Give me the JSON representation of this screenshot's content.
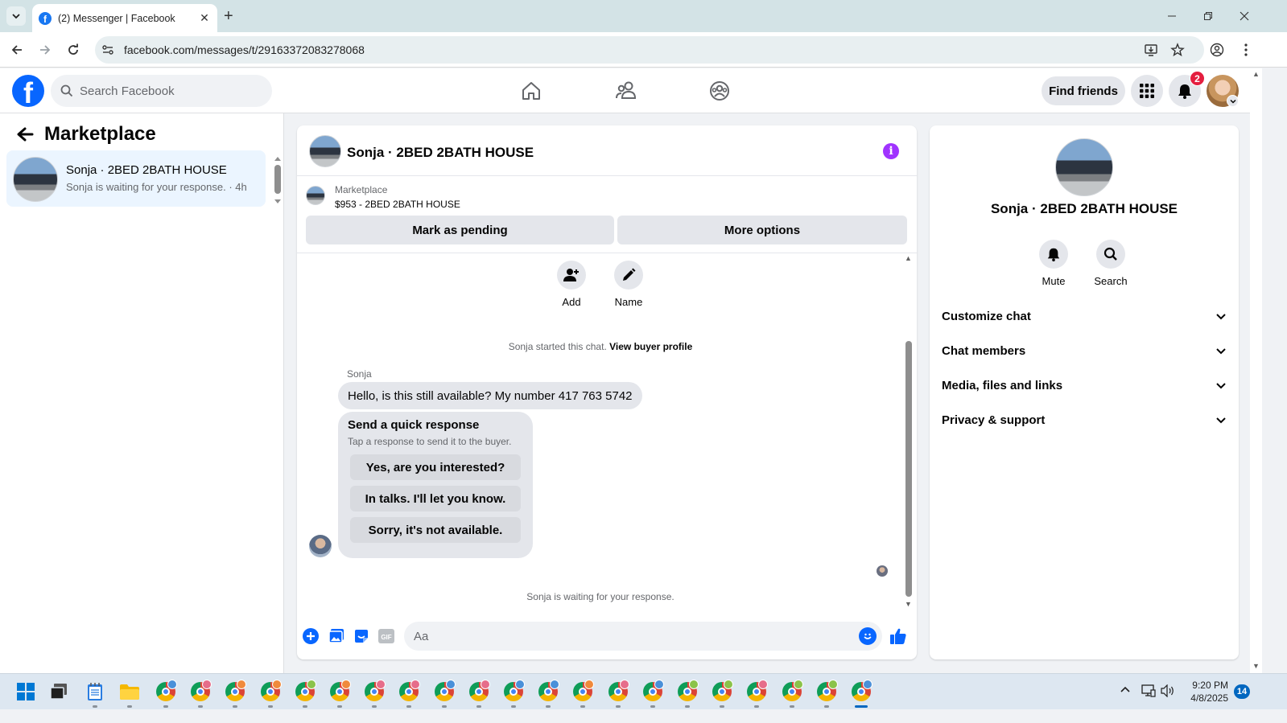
{
  "browser": {
    "tab_title": "(2) Messenger | Facebook",
    "url": "facebook.com/messages/t/29163372083278068"
  },
  "fb_header": {
    "search_placeholder": "Search Facebook",
    "find_friends_label": "Find friends",
    "notification_count": "2"
  },
  "left_pane": {
    "title": "Marketplace",
    "conversations": [
      {
        "name": "Sonja · 2BED 2BATH HOUSE",
        "preview": "Sonja is waiting for your response. · 4h"
      }
    ]
  },
  "chat": {
    "header_name": "Sonja · 2BED 2BATH HOUSE",
    "listing_source": "Marketplace",
    "listing_price_title": "$953 - 2BED 2BATH HOUSE",
    "mark_pending_label": "Mark as pending",
    "more_options_label": "More options",
    "add_label": "Add",
    "name_label": "Name",
    "started_text": "Sonja started this chat.",
    "view_profile_label": "View buyer profile",
    "sender_name": "Sonja",
    "message": "Hello, is this still available? My number 417 763 5742",
    "quick_title": "Send a quick response",
    "quick_subtitle": "Tap a response to send it to the buyer.",
    "quick_responses": [
      "Yes, are you interested?",
      "In talks. I'll let you know.",
      "Sorry, it's not available."
    ],
    "waiting_text": "Sonja is waiting for your response.",
    "composer_placeholder": "Aa"
  },
  "right_pane": {
    "name": "Sonja · 2BED 2BATH HOUSE",
    "mute_label": "Mute",
    "search_label": "Search",
    "sections": [
      "Customize chat",
      "Chat members",
      "Media, files and links",
      "Privacy & support"
    ]
  },
  "taskbar": {
    "time": "9:20 PM",
    "date": "4/8/2025",
    "notification_count": "14",
    "chrome_profile_colors": [
      "#4a90d9",
      "#e66d8a",
      "#f08a3c",
      "#f08a3c",
      "#8bc34a",
      "#f08a3c",
      "#e66d8a",
      "#e66d8a",
      "#4a90d9",
      "#e66d8a",
      "#4a90d9",
      "#4a90d9",
      "#f08a3c",
      "#e66d8a",
      "#4a90d9",
      "#8bc34a",
      "#8bc34a",
      "#e66d8a",
      "#8bc34a",
      "#8bc34a",
      "#4a90d9"
    ]
  },
  "colors": {
    "fb_blue": "#0866ff",
    "selected_bg": "#ebf5ff",
    "info_purple": "#a033ff",
    "badge_red": "#e41e3f"
  }
}
